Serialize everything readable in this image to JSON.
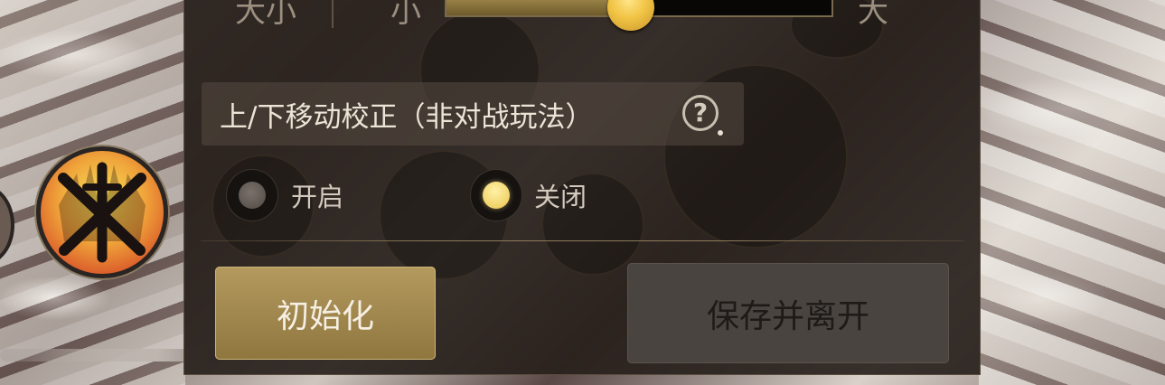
{
  "settings": {
    "size": {
      "label": "大小",
      "min_label": "小",
      "max_label": "大",
      "value_fraction": 0.48
    },
    "vertical_correction": {
      "title": "上/下移动校正（非对战玩法）",
      "help_glyph": "?",
      "options": [
        {
          "label": "开启",
          "selected": false
        },
        {
          "label": "关闭",
          "selected": true
        }
      ]
    },
    "buttons": {
      "reset_label": "初始化",
      "save_exit_label": "保存并离开"
    }
  },
  "colors": {
    "accent_gold": "#f1c445",
    "panel_bg": "#28211c",
    "reset_button": "#a2884e"
  },
  "icons": [
    "skill-crossed-swords-icon",
    "help-icon"
  ]
}
